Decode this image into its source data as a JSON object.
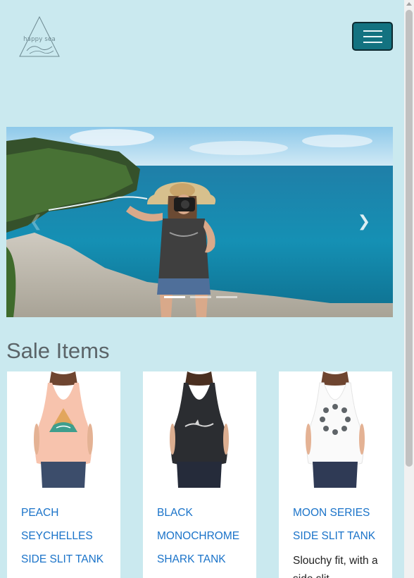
{
  "header": {
    "logo_text": "happy sea",
    "menu_icon": "hamburger-icon"
  },
  "carousel": {
    "prev_icon": "chevron-left-icon",
    "prev_glyph": "❮",
    "next_icon": "chevron-right-icon",
    "next_glyph": "❯",
    "slide_count": 3,
    "active_index": 0
  },
  "sale": {
    "title": "Sale Items",
    "items": [
      {
        "name": "Peach Seychelles Side Slit Tank",
        "description": ""
      },
      {
        "name": "Black Monochrome Shark Tank",
        "description": ""
      },
      {
        "name": "Moon Series Side Slit Tank",
        "description": "Slouchy fit, with a side slit"
      }
    ]
  },
  "colors": {
    "background": "#cae9ef",
    "menu_button": "#137280",
    "link": "#1a73c9",
    "heading": "#5b6468"
  }
}
